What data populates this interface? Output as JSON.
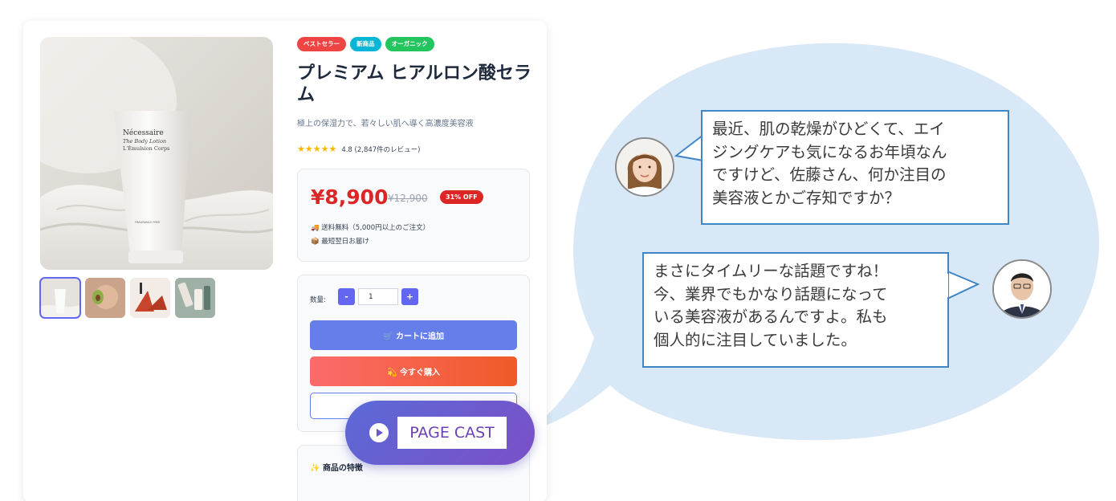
{
  "product": {
    "badges": [
      "ベストセラー",
      "新商品",
      "オーガニック"
    ],
    "title": "プレミアム ヒアルロン酸セラム",
    "subtitle": "極上の保湿力で、若々しい肌へ導く高濃度美容液",
    "stars": "★★★★★",
    "rating_text": "4.8 (2,847件のレビュー)",
    "rating_value": 4.8,
    "price": "¥8,900",
    "old_price": "¥12,900",
    "discount": "31% OFF",
    "shipping": "🚚 送料無料（5,000円以上のご注文）",
    "delivery": "📦 最短翌日お届け",
    "quantity_label": "数量:",
    "quantity_minus": "-",
    "quantity_value": "1",
    "quantity_plus": "+",
    "cart_button": "🛒 カートに追加",
    "buy_button": "💫 今すぐ購入",
    "features_icon": "✨",
    "features_title": "商品の特徴",
    "image_label_brand": "Nécessaire",
    "image_label_line1": "The Body Lotion",
    "image_label_line2": "L'Émulsion Corps",
    "image_label_small": "FRAGRANCE FREE"
  },
  "pagecast": {
    "label": "PAGE CAST",
    "icon": "play-icon"
  },
  "dialogue": {
    "woman_line": "最近、肌の乾燥がひどくて、エイ\nジングケアも気になるお年頃なん\nですけど、佐藤さん、何か注目の\n美容液とかご存知ですか？",
    "man_line": "まさにタイムリーな話題ですね！\n今、業界でもかなり話題になって\nいる美容液があるんですよ。私も\n個人的に注目していました。"
  },
  "colors": {
    "accent": "#667eea",
    "price": "#dc2626",
    "bubble": "#d9e8f6",
    "speech_border": "#3f86c9"
  }
}
